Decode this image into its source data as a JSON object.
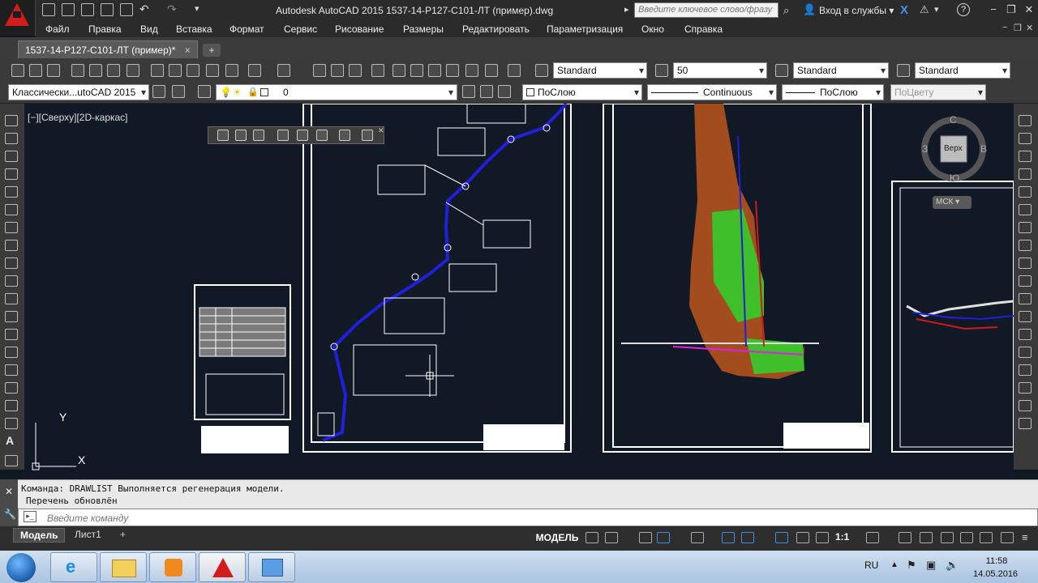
{
  "window": {
    "title": "Autodesk AutoCAD 2015    1537-14-Р127-С101-ЛТ (пример).dwg",
    "search_placeholder": "Введите ключевое слово/фразу",
    "signin": "Вход в службы",
    "help": "?"
  },
  "menu": [
    "Файл",
    "Правка",
    "Вид",
    "Вставка",
    "Формат",
    "Сервис",
    "Рисование",
    "Размеры",
    "Редактировать",
    "Параметризация",
    "Окно",
    "Справка"
  ],
  "document_tab": {
    "label": "1537-14-Р127-С101-ЛТ (пример)*",
    "close": "×",
    "new": "+"
  },
  "toolbar1": {
    "text_style": "Standard",
    "dim_scale": "50",
    "dim_style": "Standard",
    "table_style": "Standard"
  },
  "toolbar2": {
    "workspace": "Классически...utoCAD 2015",
    "layer": "0",
    "color": "ПоСлою",
    "linetype": "Continuous",
    "lineweight": "ПоСлою",
    "plotstyle": "ПоЦвету"
  },
  "viewport": {
    "label": "[−][Сверху][2D-каркас]",
    "viewcube": {
      "top": "Верх",
      "n": "С",
      "s": "Ю",
      "w": "З",
      "e": "В"
    },
    "ucs_label": "МСК",
    "axis_y": "Y",
    "axis_x": "X"
  },
  "command": {
    "history": [
      "Команда: DRAWLIST Выполняется регенерация модели.",
      "Перечень обновлён"
    ],
    "input_placeholder": "Введите команду"
  },
  "layout_tabs": [
    {
      "label": "Модель",
      "active": true
    },
    {
      "label": "Лист1",
      "active": false
    }
  ],
  "add_layout": "+",
  "status": {
    "model": "МОДЕЛЬ",
    "scale": "1:1"
  },
  "taskbar": {
    "lang": "RU",
    "time": "11:58",
    "date": "14.05.2016"
  },
  "colors": {
    "accent": "#d11c1c",
    "canvas": "#111926",
    "road": "#1a1acc",
    "terrain": "#3fbf2a"
  }
}
